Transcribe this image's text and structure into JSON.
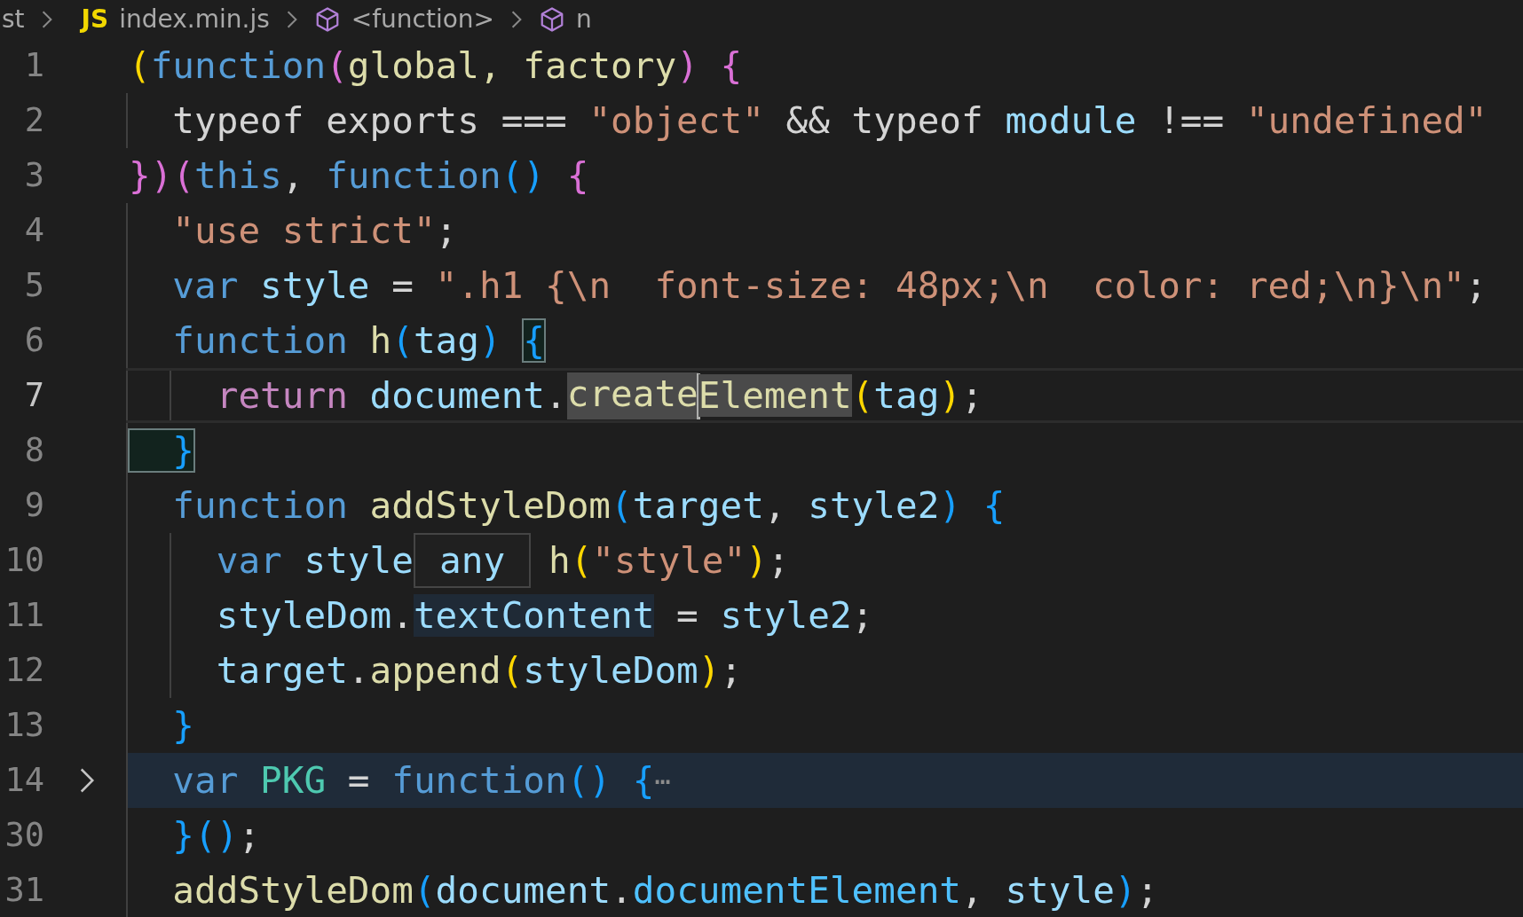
{
  "breadcrumb": [
    {
      "kind": "folder",
      "label": "st"
    },
    {
      "kind": "file",
      "type_label": "JS",
      "label": "index.min.js"
    },
    {
      "kind": "symbol",
      "label": "<function>"
    },
    {
      "kind": "symbol",
      "label": "n"
    }
  ],
  "lines": [
    {
      "number": "1",
      "current": false,
      "folded": false,
      "tokens": [
        {
          "text": "(",
          "kind": "b1"
        },
        {
          "text": "function",
          "kind": "kw"
        },
        {
          "text": "(",
          "kind": "b2"
        },
        {
          "text": "global, factory",
          "kind": "fn"
        },
        {
          "text": ") ",
          "kind": "b2"
        },
        {
          "text": "{",
          "kind": "b2"
        }
      ]
    },
    {
      "number": "2",
      "current": false,
      "folded": false,
      "tokens": [
        {
          "text": "  typeof exports === ",
          "kind": "plain"
        },
        {
          "text": "\"object\"",
          "kind": "str"
        },
        {
          "text": " && typeof ",
          "kind": "plain"
        },
        {
          "text": "module",
          "kind": "var"
        },
        {
          "text": " !== ",
          "kind": "plain"
        },
        {
          "text": "\"undefined\"",
          "kind": "str"
        }
      ]
    },
    {
      "number": "3",
      "current": false,
      "folded": false,
      "tokens": [
        {
          "text": "}",
          "kind": "b2"
        },
        {
          "text": ")",
          "kind": "b2"
        },
        {
          "text": "(",
          "kind": "b2"
        },
        {
          "text": "this",
          "kind": "kw"
        },
        {
          "text": ", ",
          "kind": "plain"
        },
        {
          "text": "function",
          "kind": "kw"
        },
        {
          "text": "() ",
          "kind": "b3"
        },
        {
          "text": "{",
          "kind": "b2"
        }
      ]
    },
    {
      "number": "4",
      "current": false,
      "folded": false,
      "tokens": [
        {
          "text": "  \"use strict\"",
          "kind": "str"
        },
        {
          "text": ";",
          "kind": "plain"
        }
      ]
    },
    {
      "number": "5",
      "current": false,
      "folded": false,
      "tokens": [
        {
          "text": "  var ",
          "kind": "kw"
        },
        {
          "text": "style",
          "kind": "var"
        },
        {
          "text": " = ",
          "kind": "plain"
        },
        {
          "text": "\".h1 {\\n  font-size: 48px;\\n  color: red;\\n}\\n\"",
          "kind": "str"
        },
        {
          "text": ";",
          "kind": "plain"
        }
      ]
    },
    {
      "number": "6",
      "current": false,
      "folded": false,
      "tokens": [
        {
          "text": "  function ",
          "kind": "kw"
        },
        {
          "text": "h",
          "kind": "fn"
        },
        {
          "text": "(",
          "kind": "b3"
        },
        {
          "text": "tag",
          "kind": "var"
        },
        {
          "text": ") ",
          "kind": "b3"
        },
        {
          "text": "{",
          "kind": "b3",
          "matched": true
        }
      ]
    },
    {
      "number": "7",
      "current": true,
      "folded": false,
      "tokens": [
        {
          "text": "    return ",
          "kind": "ctrl"
        },
        {
          "text": "document",
          "kind": "var"
        },
        {
          "text": ".",
          "kind": "plain"
        },
        {
          "text": "create",
          "kind": "fn",
          "word_highlight": true,
          "cursor": true
        },
        {
          "text": "Element",
          "kind": "fn",
          "word_highlight": true
        },
        {
          "text": "(",
          "kind": "b1"
        },
        {
          "text": "tag",
          "kind": "var"
        },
        {
          "text": ")",
          "kind": "b1"
        },
        {
          "text": ";",
          "kind": "plain"
        }
      ]
    },
    {
      "number": "8",
      "current": false,
      "folded": false,
      "tokens": [
        {
          "text": "  }",
          "kind": "b3",
          "matched": true
        }
      ]
    },
    {
      "number": "9",
      "current": false,
      "folded": false,
      "tokens": [
        {
          "text": "  function ",
          "kind": "kw"
        },
        {
          "text": "addStyleDom",
          "kind": "fn"
        },
        {
          "text": "(",
          "kind": "b3"
        },
        {
          "text": "target",
          "kind": "var"
        },
        {
          "text": ", ",
          "kind": "plain"
        },
        {
          "text": "style2",
          "kind": "var"
        },
        {
          "text": ") ",
          "kind": "b3"
        },
        {
          "text": "{",
          "kind": "b3"
        }
      ]
    },
    {
      "number": "10",
      "current": false,
      "folded": false,
      "tokens": [
        {
          "text": "    var ",
          "kind": "kw"
        },
        {
          "text": "style",
          "kind": "var"
        },
        {
          "text": "any",
          "kind": "tooltip"
        },
        {
          "text": "h",
          "kind": "fn"
        },
        {
          "text": "(",
          "kind": "b1"
        },
        {
          "text": "\"style\"",
          "kind": "str"
        },
        {
          "text": ")",
          "kind": "b1"
        },
        {
          "text": ";",
          "kind": "plain"
        }
      ]
    },
    {
      "number": "11",
      "current": false,
      "folded": false,
      "tokens": [
        {
          "text": "    styleDom",
          "kind": "var"
        },
        {
          "text": ".",
          "kind": "plain"
        },
        {
          "text": "textContent",
          "kind": "var",
          "match_highlight": true
        },
        {
          "text": " = ",
          "kind": "plain"
        },
        {
          "text": "style2",
          "kind": "var"
        },
        {
          "text": ";",
          "kind": "plain"
        }
      ]
    },
    {
      "number": "12",
      "current": false,
      "folded": false,
      "tokens": [
        {
          "text": "    target",
          "kind": "var"
        },
        {
          "text": ".",
          "kind": "plain"
        },
        {
          "text": "append",
          "kind": "fn"
        },
        {
          "text": "(",
          "kind": "b1"
        },
        {
          "text": "styleDom",
          "kind": "var"
        },
        {
          "text": ")",
          "kind": "b1"
        },
        {
          "text": ";",
          "kind": "plain"
        }
      ]
    },
    {
      "number": "13",
      "current": false,
      "folded": false,
      "tokens": [
        {
          "text": "  }",
          "kind": "b3"
        }
      ]
    },
    {
      "number": "14",
      "current": false,
      "folded": true,
      "tokens": [
        {
          "text": "  var ",
          "kind": "kw"
        },
        {
          "text": "PKG",
          "kind": "const"
        },
        {
          "text": " = ",
          "kind": "plain"
        },
        {
          "text": "function",
          "kind": "kw"
        },
        {
          "text": "() ",
          "kind": "b3"
        },
        {
          "text": "{",
          "kind": "b3"
        },
        {
          "text": "⋯",
          "kind": "fold"
        }
      ]
    },
    {
      "number": "30",
      "current": false,
      "folded": false,
      "tokens": [
        {
          "text": "  }",
          "kind": "b3"
        },
        {
          "text": "()",
          "kind": "b3"
        },
        {
          "text": ";",
          "kind": "plain"
        }
      ]
    },
    {
      "number": "31",
      "current": false,
      "folded": false,
      "tokens": [
        {
          "text": "  addStyleDom",
          "kind": "fn"
        },
        {
          "text": "(",
          "kind": "b3"
        },
        {
          "text": "document",
          "kind": "var"
        },
        {
          "text": ".",
          "kind": "plain"
        },
        {
          "text": "documentElement",
          "kind": "prop"
        },
        {
          "text": ", ",
          "kind": "plain"
        },
        {
          "text": "style",
          "kind": "var"
        },
        {
          "text": ")",
          "kind": "b3"
        },
        {
          "text": ";",
          "kind": "plain"
        }
      ]
    }
  ]
}
